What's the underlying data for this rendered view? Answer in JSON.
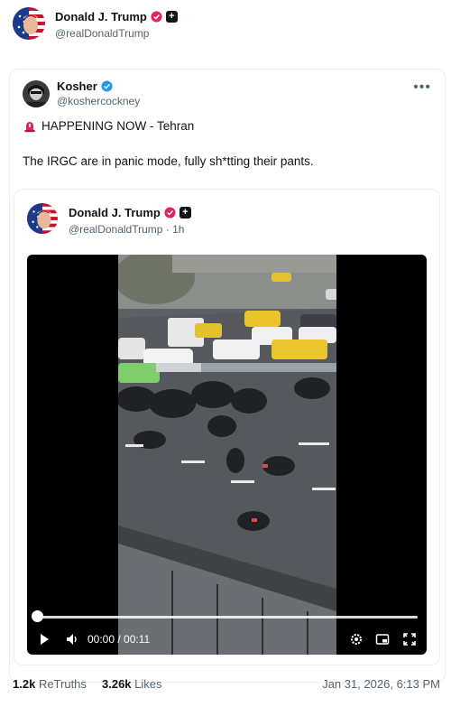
{
  "post": {
    "author_name": "Donald J. Trump",
    "author_handle": "@realDonaldTrump"
  },
  "quoted": {
    "author_name": "Kosher",
    "author_handle": "@koshercockney",
    "line1": "HAPPENING NOW - Tehran",
    "line2": "The IRGC are in panic mode, fully sh*tting their pants.",
    "more_label": "•••"
  },
  "inner": {
    "author_name": "Donald J. Trump",
    "author_handle": "@realDonaldTrump · 1h"
  },
  "video": {
    "time": "00:00 / 00:11",
    "progress": 0.0
  },
  "stats": {
    "retruths_count": "1.2k",
    "retruths_label": "ReTruths",
    "likes_count": "3.26k",
    "likes_label": "Likes",
    "date": "Jan 31, 2026, 6:13 PM"
  },
  "colors": {
    "accent_red": "#e0245e",
    "verified_blue": "#1d9bf0"
  }
}
